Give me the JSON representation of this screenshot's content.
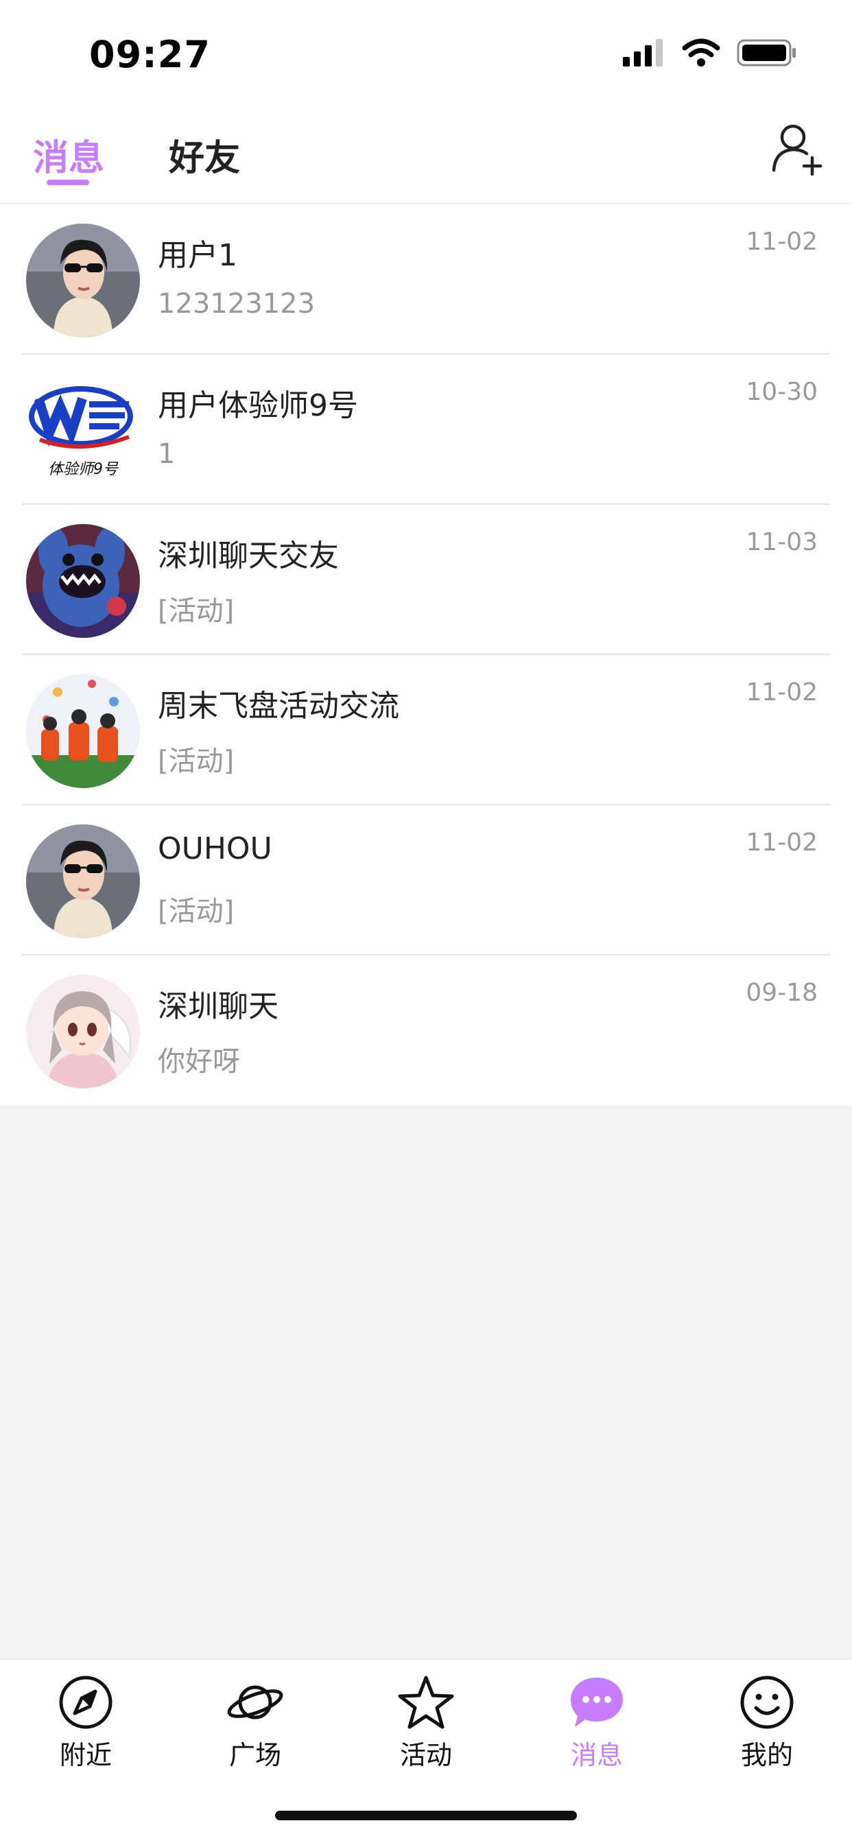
{
  "status_bar": {
    "time": "09:27"
  },
  "header": {
    "tabs": [
      {
        "label": "消息",
        "active": true
      },
      {
        "label": "好友",
        "active": false
      }
    ],
    "add_friend_icon": "add-friend-icon"
  },
  "conversations": [
    {
      "name": "用户1",
      "preview": "123123123",
      "time": "11-02",
      "avatar": "photo-woman-sunglasses"
    },
    {
      "name": "用户体验师9号",
      "preview": "1",
      "time": "10-30",
      "avatar": "logo-w-blue",
      "avatar_text": "体验师9号"
    },
    {
      "name": "深圳聊天交友",
      "preview": "[活动]",
      "time": "11-03",
      "avatar": "photo-blue-monster"
    },
    {
      "name": "周末飞盘活动交流",
      "preview": "[活动]",
      "time": "11-02",
      "avatar": "photo-frisbee-group"
    },
    {
      "name": "OUHOU",
      "preview": "[活动]",
      "time": "11-02",
      "avatar": "photo-woman-sunglasses"
    },
    {
      "name": "深圳聊天",
      "preview": "你好呀",
      "time": "09-18",
      "avatar": "illustration-anime-girl"
    }
  ],
  "tabbar": {
    "items": [
      {
        "label": "附近",
        "icon": "compass-icon",
        "active": false
      },
      {
        "label": "广场",
        "icon": "planet-icon",
        "active": false
      },
      {
        "label": "活动",
        "icon": "star-icon",
        "active": false
      },
      {
        "label": "消息",
        "icon": "chat-bubble-icon",
        "active": true
      },
      {
        "label": "我的",
        "icon": "smiley-icon",
        "active": false
      }
    ]
  },
  "colors": {
    "accent": "#c77dff",
    "background": "#f4f4f4",
    "text": "#222222",
    "muted": "#999999"
  }
}
